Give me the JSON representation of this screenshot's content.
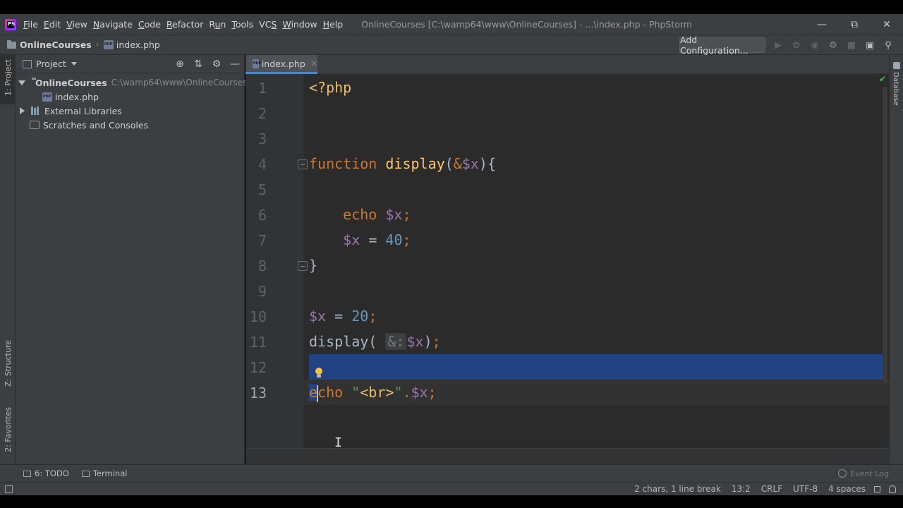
{
  "menu": {
    "items": [
      {
        "pre": "",
        "mn": "F",
        "post": "ile"
      },
      {
        "pre": "",
        "mn": "E",
        "post": "dit"
      },
      {
        "pre": "",
        "mn": "V",
        "post": "iew"
      },
      {
        "pre": "",
        "mn": "N",
        "post": "avigate"
      },
      {
        "pre": "",
        "mn": "C",
        "post": "ode"
      },
      {
        "pre": "",
        "mn": "R",
        "post": "efactor"
      },
      {
        "pre": "R",
        "mn": "u",
        "post": "n"
      },
      {
        "pre": "",
        "mn": "T",
        "post": "ools"
      },
      {
        "pre": "VC",
        "mn": "S",
        "post": ""
      },
      {
        "pre": "",
        "mn": "W",
        "post": "indow"
      },
      {
        "pre": "",
        "mn": "H",
        "post": "elp"
      }
    ],
    "window_title": "OnlineCourses [C:\\wamp64\\www\\OnlineCourses] - ...\\index.php - PhpStorm",
    "logo_text": "PS"
  },
  "navbar": {
    "project": "OnlineCourses",
    "file": "index.php",
    "add_configuration": "Add Configuration..."
  },
  "left_strip": {
    "project_tab": "1: Project",
    "structure_tab": "Z: Structure",
    "favorites_tab": "2: Favorites"
  },
  "project_panel": {
    "title": "Project",
    "root_name": "OnlineCourses",
    "root_path": "C:\\wamp64\\www\\OnlineCourses",
    "file": "index.php",
    "external_libraries": "External Libraries",
    "scratches": "Scratches and Consoles"
  },
  "editor": {
    "tab_label": "index.php",
    "line_numbers": [
      "1",
      "2",
      "3",
      "4",
      "5",
      "6",
      "7",
      "8",
      "9",
      "10",
      "11",
      "12",
      "13"
    ],
    "current_line": "13"
  },
  "right_strip": {
    "database_tab": "Database"
  },
  "bottom_tools": {
    "todo": "6: TODO",
    "terminal": "Terminal",
    "event_log": "Event Log"
  },
  "status": {
    "selection": "2 chars, 1 line break",
    "position": "13:2",
    "line_sep": "CRLF",
    "encoding": "UTF-8",
    "indent": "4 spaces"
  },
  "colors": {
    "keyword": "#cc7832",
    "function": "#ffc66d",
    "variable": "#9876aa",
    "number": "#6897bb",
    "string": "#6a8759",
    "selection": "#214283"
  }
}
